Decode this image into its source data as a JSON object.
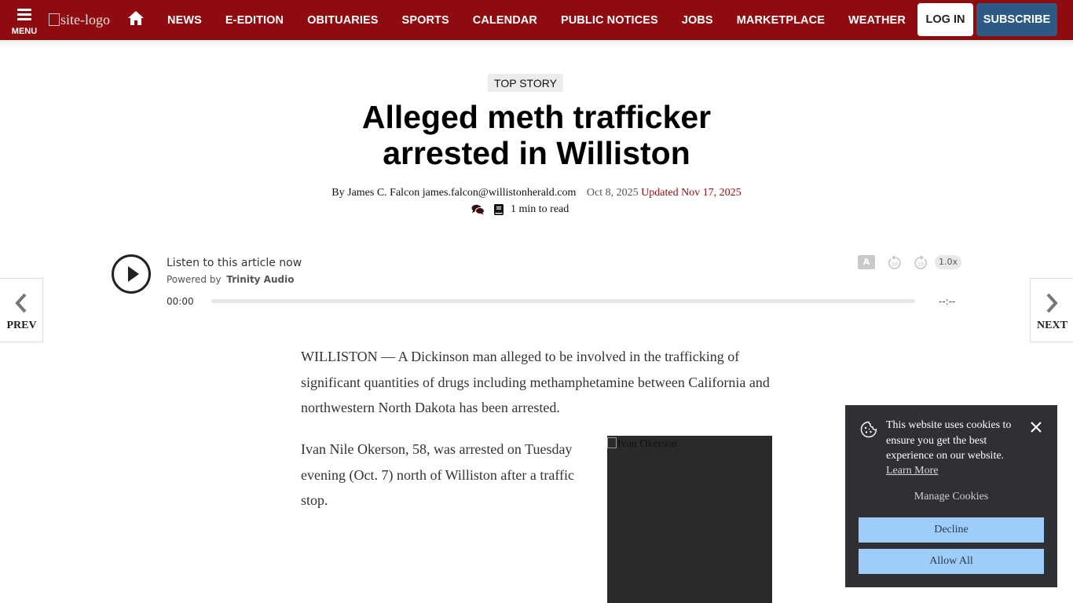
{
  "nav": {
    "menu_label": "MENU",
    "logo_alt": "site-logo",
    "links": [
      "NEWS",
      "E-EDITION",
      "OBITUARIES",
      "SPORTS",
      "CALENDAR",
      "PUBLIC NOTICES",
      "JOBS",
      "MARKETPLACE",
      "WEATHER"
    ],
    "login": "LOG IN",
    "subscribe": "SUBSCRIBE",
    "bar_color": "#8e0b0f",
    "subscribe_color": "#2d5985"
  },
  "article": {
    "category": "TOP STORY",
    "headline_line1": "Alleged meth trafficker",
    "headline_line2": "arrested in Williston",
    "byline": "By James C. Falcon james.falcon@willistonherald.com",
    "date": "Oct 8, 2025",
    "updated": "Updated Nov 17, 2025",
    "read_time": "1 min to read",
    "paragraphs": [
      "WILLISTON — A Dickinson man alleged to be involved in the trafficking of significant quantities of drugs including methamphetamine between California and northwestern North Dakota has been arrested.",
      "Ivan Nile Okerson, 58, was arrested on Tuesday evening (Oct. 7) north of Williston after a traffic stop."
    ],
    "photo_alt": "Ivan Okerson"
  },
  "player": {
    "listen": "Listen to this article now",
    "powered_by": "Powered by",
    "provider": "Trinity Audio",
    "current_time": "00:00",
    "duration": "--:--",
    "speed": "1.0x",
    "rewind_seconds": "10",
    "forward_seconds": "10"
  },
  "side_nav": {
    "prev": "PREV",
    "next": "NEXT"
  },
  "cookie": {
    "message": "This website uses cookies to ensure you get the best experience on our website.",
    "learn_more": "Learn More",
    "manage": "Manage Cookies",
    "decline": "Decline",
    "allow": "Allow All"
  }
}
